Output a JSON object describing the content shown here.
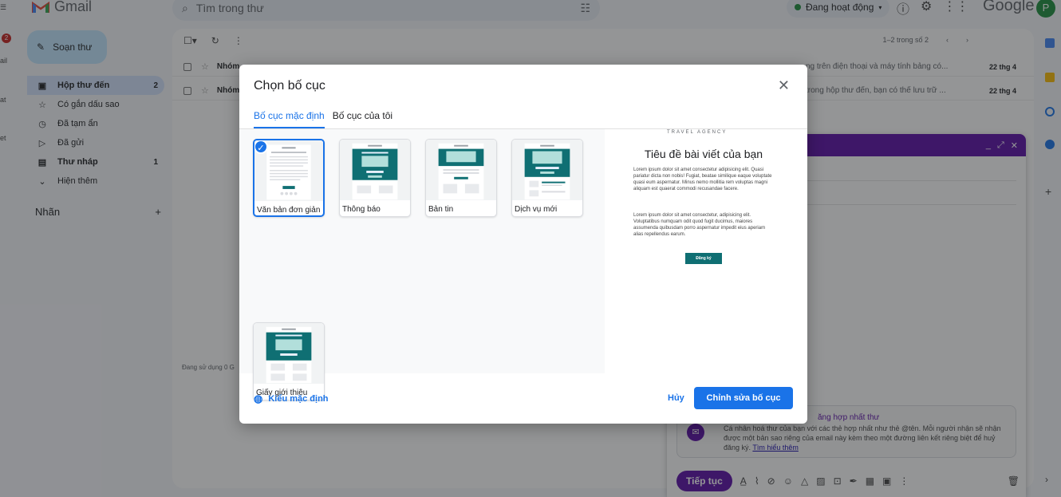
{
  "app": {
    "name": "Gmail",
    "brand_word": "Google",
    "avatar_letter": "P"
  },
  "rail": {
    "badge": "2",
    "labels": [
      "ail",
      "at",
      "et"
    ]
  },
  "search": {
    "placeholder": "Tìm trong thư"
  },
  "status": {
    "label": "Đang hoạt động"
  },
  "compose": {
    "label": "Soạn thư"
  },
  "nav": [
    {
      "label": "Hộp thư đến",
      "count": "2",
      "icon": "inbox-icon"
    },
    {
      "label": "Có gắn dấu sao",
      "count": "",
      "icon": "star-icon"
    },
    {
      "label": "Đã tạm ẩn",
      "count": "",
      "icon": "clock-icon"
    },
    {
      "label": "Đã gửi",
      "count": "",
      "icon": "send-icon"
    },
    {
      "label": "Thư nháp",
      "count": "1",
      "icon": "draft-icon"
    },
    {
      "label": "Hiện thêm",
      "count": "",
      "icon": "chevron-down-icon"
    }
  ],
  "labels_heading": "Nhãn",
  "mail": {
    "pager": "1–2 trong số 2",
    "rows": [
      {
        "sender": "Nhóm",
        "snippet": "ng trên điện thoại và máy tính bảng có...",
        "date": "22 thg 4"
      },
      {
        "sender": "Nhóm",
        "snippet": "trong hộp thư đến, bạn có thể lưu trữ ...",
        "date": "22 thg 4"
      }
    ],
    "storage": "Đang sử dụng 0 G"
  },
  "compose_window": {
    "merge_title": "ăng hợp nhất thư",
    "merge_text": "Cá nhân hoá thư của bạn với các thẻ hợp nhất như thẻ @tên. Mỗi người nhận sẽ nhận được một bản sao riêng của email này kèm theo một đường liên kết riêng biệt để huỷ đăng ký.",
    "merge_link": "Tìm hiểu thêm",
    "send_label": "Tiếp tục"
  },
  "modal": {
    "title": "Chọn bố cục",
    "tabs": [
      "Bố cục mặc định",
      "Bố cục của tôi"
    ],
    "layouts": [
      {
        "label": "Văn bản đơn giản",
        "selected": true
      },
      {
        "label": "Thông báo",
        "selected": false
      },
      {
        "label": "Bản tin",
        "selected": false
      },
      {
        "label": "Dịch vụ mới",
        "selected": false
      },
      {
        "label": "Giấy giới thiệu",
        "selected": false
      }
    ],
    "preview": {
      "brand": "TRAVEL    AGENCY",
      "title": "Tiêu đề bài viết của bạn",
      "para1": "Lorem ipsum dolor sit amet consectetur adipisicing elit. Quasi pariatur dicta non nobis! Fugiat, beatae similique eaque voluptate quasi eum aspernatur. Minus nemo mollitia rem voluptas magni aliquam est quaerat commodi recusandae facere.",
      "para2": "Lorem ipsum dolor sit amet consectetur, adipisicing elit. Voluptatibus numquam odit quod fugit ducimus, maiores assumenda quibusdam porro aspernatur impedit eius aperiam alias repellendus earum.",
      "button": "Đăng ký"
    },
    "default_style": "Kiểu mặc định",
    "cancel": "Hủy",
    "edit": "Chỉnh sửa bố cục"
  },
  "colors": {
    "accent": "#1a73e8",
    "teal": "#0f6f73",
    "compose_purple": "#5b0ea8"
  }
}
